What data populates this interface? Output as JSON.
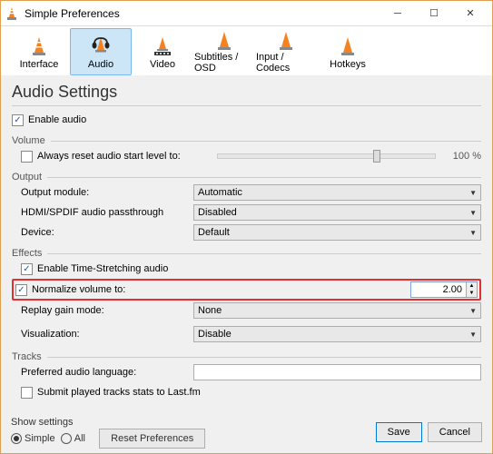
{
  "window": {
    "title": "Simple Preferences"
  },
  "tabs": {
    "interface": "Interface",
    "audio": "Audio",
    "video": "Video",
    "subtitles": "Subtitles / OSD",
    "input": "Input / Codecs",
    "hotkeys": "Hotkeys"
  },
  "heading": "Audio Settings",
  "enable_audio": "Enable audio",
  "sections": {
    "volume": "Volume",
    "output": "Output",
    "effects": "Effects",
    "tracks": "Tracks"
  },
  "volume": {
    "always_reset": "Always reset audio start level to:",
    "percent": "100 %"
  },
  "output": {
    "module_label": "Output module:",
    "module_value": "Automatic",
    "spdif_label": "HDMI/SPDIF audio passthrough",
    "spdif_value": "Disabled",
    "device_label": "Device:",
    "device_value": "Default"
  },
  "effects": {
    "timestretch": "Enable Time-Stretching audio",
    "normalize": "Normalize volume to:",
    "normalize_value": "2.00",
    "replay_label": "Replay gain mode:",
    "replay_value": "None",
    "viz_label": "Visualization:",
    "viz_value": "Disable"
  },
  "tracks": {
    "lang_label": "Preferred audio language:",
    "lastfm": "Submit played tracks stats to Last.fm"
  },
  "footer": {
    "show_settings": "Show settings",
    "simple": "Simple",
    "all": "All",
    "reset": "Reset Preferences",
    "save": "Save",
    "cancel": "Cancel"
  }
}
